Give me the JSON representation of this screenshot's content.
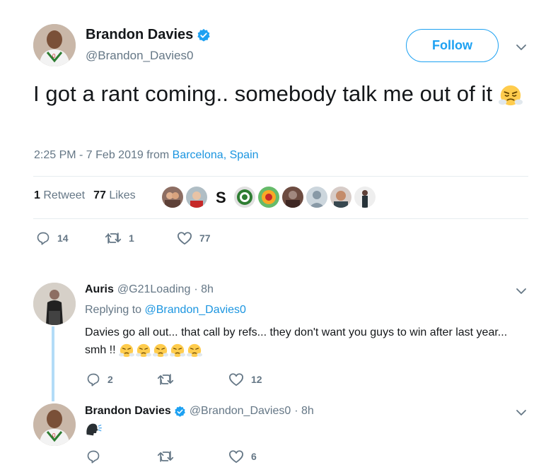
{
  "main_tweet": {
    "author_name": "Brandon Davies",
    "handle": "@Brandon_Davies0",
    "follow_label": "Follow",
    "text": "I got a rant coming.. somebody talk me out of it",
    "timestamp": "2:25 PM - 7 Feb 2019 from ",
    "location": "Barcelona, Spain",
    "retweet_count": "1",
    "retweet_label": "Retweet",
    "like_count": "77",
    "like_label": "Likes",
    "actions": {
      "replies": "14",
      "retweets": "1",
      "likes": "77"
    }
  },
  "replies": [
    {
      "author_name": "Auris",
      "handle": "@G21Loading",
      "time": "· 8h",
      "replying_prefix": "Replying to ",
      "replying_to": "@Brandon_Davies0",
      "text": "Davies go all out... that call by refs... they don't want you guys to win after last year... smh !!",
      "actions": {
        "replies": "2",
        "retweets": "",
        "likes": "12"
      }
    },
    {
      "author_name": "Brandon Davies",
      "handle": "@Brandon_Davies0",
      "time": "· 8h",
      "actions": {
        "replies": "",
        "retweets": "",
        "likes": "6"
      }
    }
  ],
  "colors": {
    "accent": "#1da1f2",
    "link": "#1b95e0",
    "muted": "#657786",
    "text": "#14171a",
    "thread": "#b3dcf7"
  },
  "icons": [
    "verified-badge-icon",
    "chevron-down-icon",
    "reply-icon",
    "retweet-icon",
    "heart-icon",
    "steaming-face-emoji",
    "speaking-head-emoji"
  ]
}
